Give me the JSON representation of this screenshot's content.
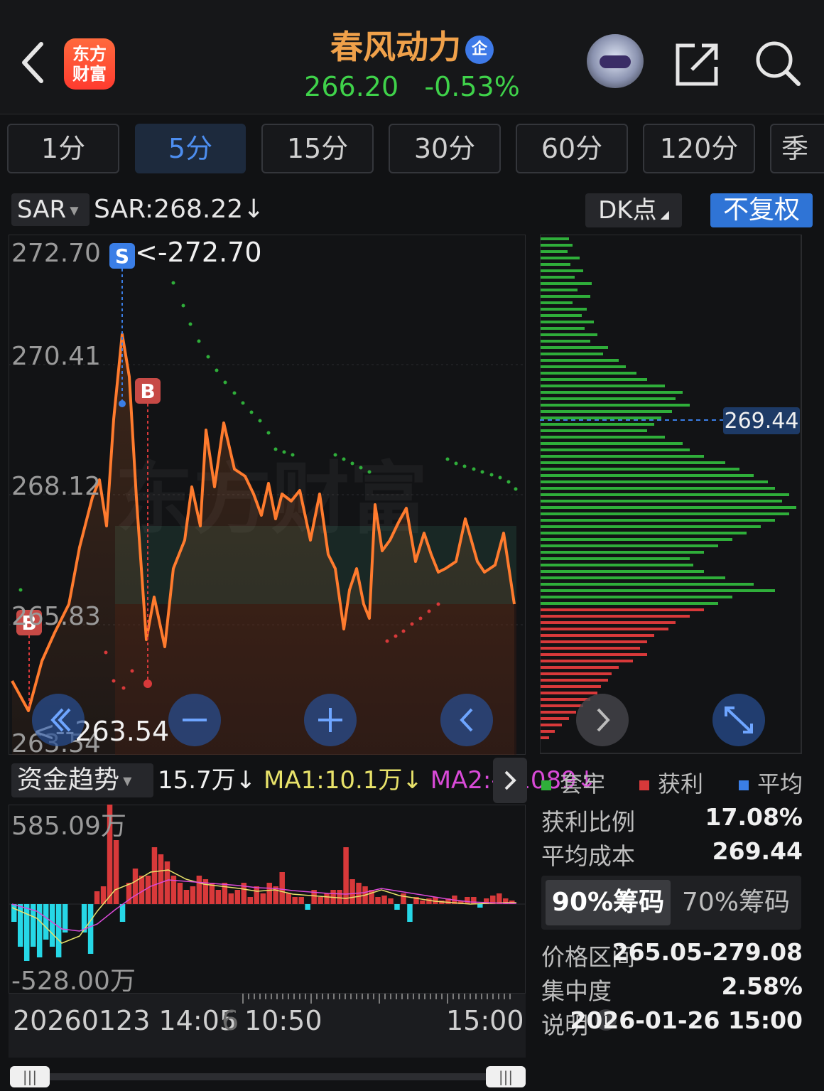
{
  "header": {
    "logo_text": "东方\n财富",
    "title": "春风动力",
    "title_badge": "企",
    "price": "266.20",
    "change_pct": "-0.53%",
    "icons": [
      "back-icon",
      "assistant-robot-icon",
      "share-icon",
      "search-icon"
    ]
  },
  "period_tabs": [
    {
      "label": "1分",
      "active": false
    },
    {
      "label": "5分",
      "active": true
    },
    {
      "label": "15分",
      "active": false
    },
    {
      "label": "30分",
      "active": false
    },
    {
      "label": "60分",
      "active": false
    },
    {
      "label": "120分",
      "active": false
    },
    {
      "label": "季",
      "active": false
    }
  ],
  "indicator": {
    "name": "SAR",
    "value_text": "SAR:268.22↓",
    "dk_label": "DK点",
    "adjust_label": "不复权"
  },
  "main_chart": {
    "y_ticks": [
      "272.70",
      "270.41",
      "268.12",
      "265.83",
      "263.54"
    ],
    "high_annotation": "<-272.70",
    "low_annotation": "<--263.54",
    "signal_markers": [
      "S",
      "B",
      "B"
    ],
    "watermark": "东方财富",
    "price_line_color": "#ff7b2e"
  },
  "chip_distribution": {
    "marker_value": "269.44",
    "legend": [
      {
        "label": "套牢",
        "color": "#2fae3a"
      },
      {
        "label": "获利",
        "color": "#d8393a"
      },
      {
        "label": "平均",
        "color": "#3a7ee6"
      }
    ],
    "stats": [
      {
        "label": "获利比例",
        "value": "17.08%"
      },
      {
        "label": "平均成本",
        "value": "269.44"
      }
    ],
    "tabs": [
      {
        "label": "90%筹码",
        "active": true
      },
      {
        "label": "70%筹码",
        "active": false
      }
    ],
    "details": [
      {
        "label": "价格区间",
        "value": "265.05-279.08"
      },
      {
        "label": "集中度",
        "value": "2.58%"
      },
      {
        "label": "说明",
        "value": "2026-01-26 15:00"
      }
    ]
  },
  "capital_trend": {
    "name": "资金趋势",
    "value": "15.7万↓",
    "ma1": "MA1:10.1万↓",
    "ma2": "MA2:-11089↓",
    "y_top": "585.09万",
    "y_bottom": "-528.00万"
  },
  "time_axis": {
    "left": "20260123 14:05",
    "left_faded": "6",
    "mid": "10:50",
    "right": "15:00"
  },
  "colors": {
    "up": "#d8393a",
    "down": "#2fae3a",
    "capital_out": "#26d7e6",
    "ma1": "#e8e26a",
    "ma2": "#d94ad8",
    "accent_blue": "#2f74d6"
  }
}
